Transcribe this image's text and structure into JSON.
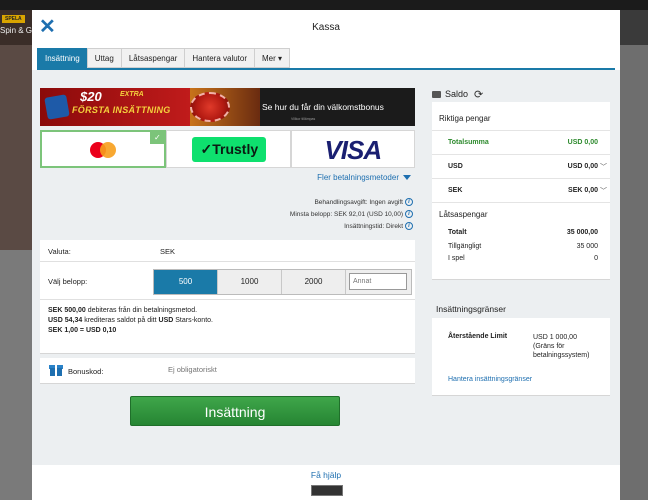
{
  "background": {
    "spela": "SPELA",
    "spin": "Spin & G"
  },
  "modal": {
    "title": "Kassa"
  },
  "tabs": [
    {
      "label": "Insättning",
      "active": true
    },
    {
      "label": "Uttag"
    },
    {
      "label": "Låtsaspengar"
    },
    {
      "label": "Hantera valutor"
    },
    {
      "label": "Mer"
    }
  ],
  "banner": {
    "amount": "$20",
    "extra_line": "EXTRA",
    "first_deposit": "FÖRSTA INSÄTTNING",
    "text": "Se hur du får din välkomstbonus",
    "sub": "Villkor tillämpas"
  },
  "payment_methods": {
    "mastercard": "mastercard-logo",
    "trustly": "Trustly",
    "visa": "VISA",
    "more": "Fler betalningsmetoder"
  },
  "fees": {
    "fee": "Behandlingsavgift: Ingen avgift",
    "min": "Minsta belopp: SEK 92,01 (USD 10,00)",
    "time": "Insättningstid: Direkt"
  },
  "form": {
    "currency_label": "Valuta:",
    "currency_value": "SEK",
    "amount_label": "Välj belopp:",
    "amounts": [
      "500",
      "1000",
      "2000"
    ],
    "selected_amount": "500",
    "other_placeholder": "Annat",
    "summary_1_bold": "SEK 500,00",
    "summary_1_rest": " debiteras från din betalningsmetod.",
    "summary_2_bold": "USD 54,34",
    "summary_2_mid": " krediteras saldot på ditt ",
    "summary_2_bold2": "USD",
    "summary_2_rest": " Stars-konto.",
    "summary_3": "SEK 1,00 = USD 0,10"
  },
  "bonus": {
    "label": "Bonuskod:",
    "placeholder": "Ej obligatoriskt"
  },
  "deposit_button": "Insättning",
  "balance": {
    "title": "Saldo",
    "real_money": "Riktiga pengar",
    "rows": [
      {
        "label": "Totalsumma",
        "value": "USD 0,00"
      },
      {
        "label": "USD",
        "value": "USD 0,00"
      },
      {
        "label": "SEK",
        "value": "SEK 0,00"
      }
    ],
    "play_money": "Låtsaspengar",
    "play_rows": [
      {
        "label": "Totalt",
        "value": "35 000,00"
      },
      {
        "label": "Tillgängligt",
        "value": "35 000"
      },
      {
        "label": "I spel",
        "value": "0"
      }
    ]
  },
  "limits": {
    "title": "Insättningsgränser",
    "remaining_label": "Återstående Limit",
    "remaining_value_1": "USD 1 000,00",
    "remaining_value_2": "(Gräns för",
    "remaining_value_3": "betalningssystem)",
    "manage_link": "Hantera insättningsgränser"
  },
  "footer": {
    "help": "Få hjälp"
  },
  "colors": {
    "accent": "#1a7aa8",
    "green": "#268533",
    "link": "#1e6fb0"
  }
}
